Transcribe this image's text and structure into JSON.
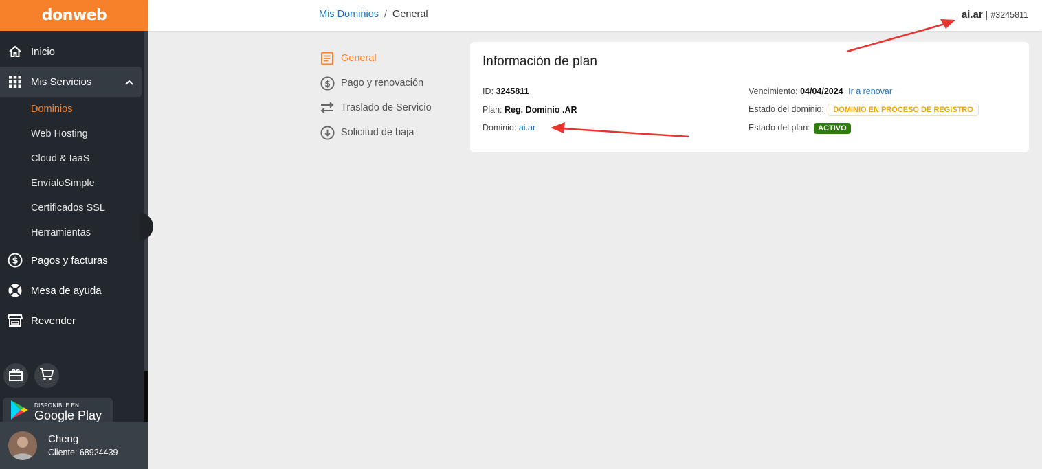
{
  "brand": {
    "logo": "donweb",
    "accent": "#f7812b"
  },
  "sidebar": {
    "items": [
      {
        "label": "Inicio",
        "icon": "home-icon"
      },
      {
        "label": "Mis Servicios",
        "icon": "grid-icon"
      },
      {
        "label": "Pagos y facturas",
        "icon": "dollar-circle-icon"
      },
      {
        "label": "Mesa de ayuda",
        "icon": "lifebuoy-icon"
      },
      {
        "label": "Revender",
        "icon": "store-icon"
      }
    ],
    "sub_items": [
      "Dominios",
      "Web Hosting",
      "Cloud & IaaS",
      "EnvíaloSimple",
      "Certificados SSL",
      "Herramientas"
    ],
    "google_play": {
      "small": "DISPONIBLE EN",
      "big": "Google Play"
    }
  },
  "user": {
    "name": "Cheng",
    "client": "Cliente: 68924439"
  },
  "header": {
    "breadcrumb": {
      "link": "Mis Dominios",
      "sep": "/",
      "current": "General"
    },
    "domain": "ai.ar",
    "sep": "|",
    "id": "#3245811"
  },
  "submenu": {
    "items": [
      {
        "label": "General",
        "icon": "document-icon"
      },
      {
        "label": "Pago y renovación",
        "icon": "dollar-circle-icon"
      },
      {
        "label": "Traslado de Servicio",
        "icon": "transfer-arrows-icon"
      },
      {
        "label": "Solicitud de baja",
        "icon": "arrow-down-circle-icon"
      }
    ]
  },
  "plan": {
    "title": "Información de plan",
    "id_label": "ID:",
    "id_value": "3245811",
    "plan_label": "Plan:",
    "plan_value": "Reg. Dominio .AR",
    "domain_label": "Dominio:",
    "domain_value": "ai.ar",
    "expiry_label": "Vencimiento:",
    "expiry_value": "04/04/2024",
    "renew_link": "Ir a renovar",
    "domain_state_label": "Estado del dominio:",
    "domain_state_value": "DOMINIO EN PROCESO DE REGISTRO",
    "plan_state_label": "Estado del plan:",
    "plan_state_value": "ACTIVO"
  }
}
